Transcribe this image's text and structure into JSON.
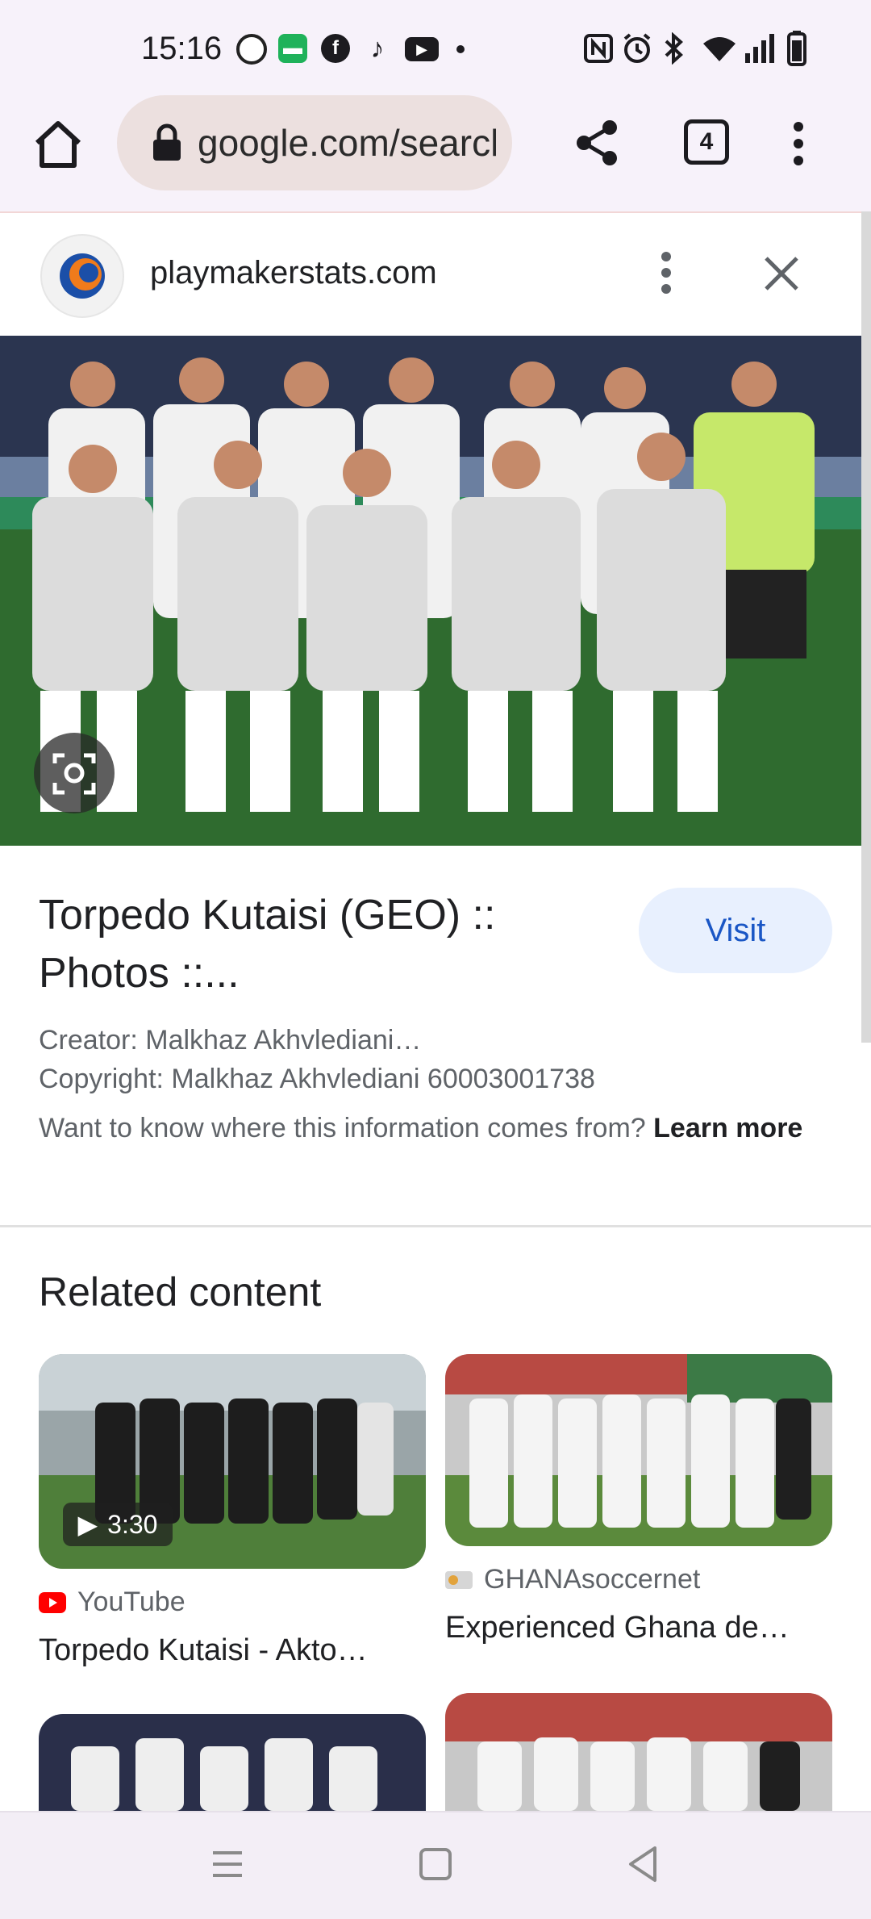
{
  "status": {
    "time": "15:16",
    "icons": [
      "viber-icon",
      "messages-icon",
      "facebook-icon",
      "tiktok-icon",
      "youtube-icon",
      "nfc-icon",
      "alarm-icon",
      "bluetooth-icon",
      "wifi-icon",
      "signal-icon",
      "battery-icon"
    ]
  },
  "toolbar": {
    "url": "google.com/search",
    "tab_count": "4"
  },
  "source": {
    "site": "playmakerstats.com"
  },
  "result": {
    "title": "Torpedo Kutaisi (GEO) :: Photos ::...",
    "visit_label": "Visit",
    "creator": "Creator: Malkhaz Akhvlediani…",
    "copyright": "Copyright: Malkhaz Akhvlediani 60003001738",
    "info_text": "Want to know where this information comes from?",
    "learn_more": "Learn more"
  },
  "related": {
    "heading": "Related content",
    "cards": [
      {
        "source": "YouTube",
        "title": "Torpedo Kutaisi - Akto…",
        "duration": "3:30"
      },
      {
        "source": "GHANAsoccernet",
        "title": "Experienced Ghana de…"
      }
    ]
  },
  "colors": {
    "chrome_bg": "#f7f2fa",
    "url_pill": "#ece0df",
    "visit_bg": "#e8f0fe",
    "visit_text": "#1a56c5",
    "youtube_red": "#ff0000"
  }
}
